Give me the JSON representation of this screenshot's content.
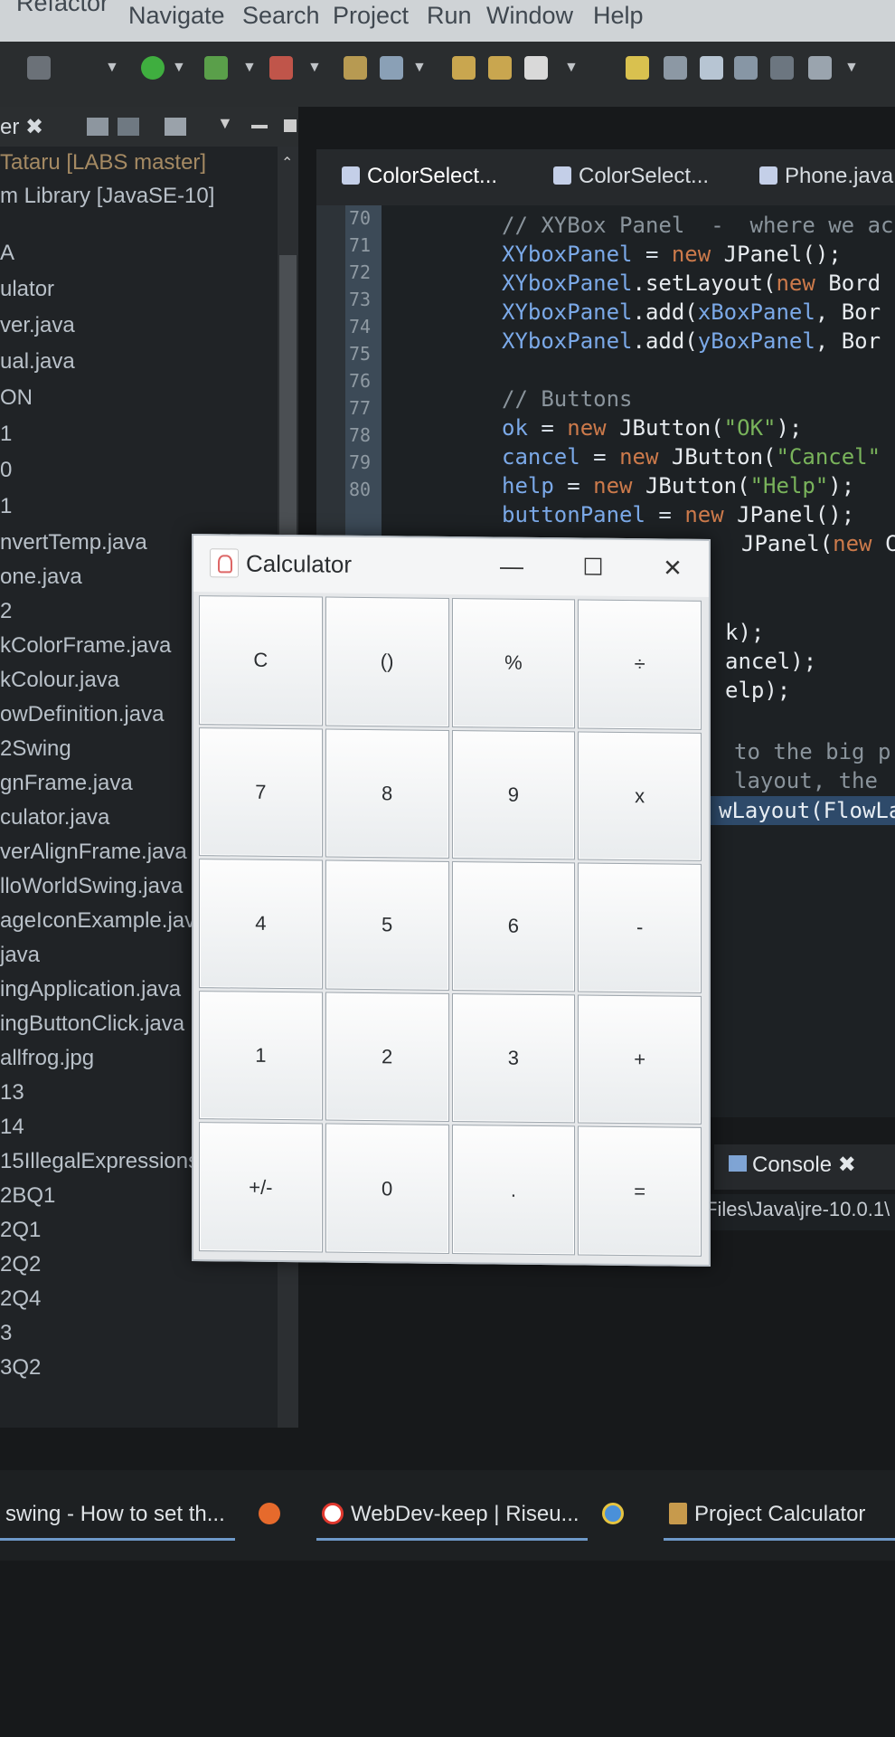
{
  "menu": {
    "items": [
      "Refactor",
      "Navigate",
      "Search",
      "Project",
      "Run",
      "Window",
      "Help"
    ]
  },
  "explorer": {
    "tab_label": "er ✖",
    "rows": [
      "Tataru [LABS master]",
      "m Library [JavaSE-10]",
      "A",
      "ulator",
      "ver.java",
      "ual.java",
      "ON",
      "1",
      "0",
      "1",
      "nvertTemp.java",
      "one.java",
      "2",
      "kColorFrame.java",
      "kColour.java",
      "owDefinition.java",
      "2Swing",
      "gnFrame.java",
      "culator.java",
      "verAlignFrame.java",
      "lloWorldSwing.java",
      "ageIconExample.jav",
      "java",
      "ingApplication.java",
      "ingButtonClick.java",
      "allfrog.jpg",
      "13",
      "14",
      "15IllegalExpressions",
      "2BQ1",
      "2Q1",
      "2Q2",
      "2Q4",
      "3",
      "3Q2"
    ]
  },
  "editor": {
    "tabs": [
      "ColorSelect...",
      "ColorSelect...",
      "Phone.java"
    ],
    "line_numbers": [
      "70",
      "71",
      "72",
      "73",
      "74",
      "75",
      "76",
      "77",
      "78",
      "79",
      "80"
    ],
    "code": {
      "l70": "// XYBox Panel  -  where we ac",
      "l71a": "XYboxPanel",
      "l71b": " = ",
      "l71c": "new",
      "l71d": " JPanel();",
      "l72a": "XYboxPanel",
      "l72b": ".setLayout(",
      "l72c": "new",
      "l72d": " Bord",
      "l73a": "XYboxPanel",
      "l73b": ".add(",
      "l73c": "xBoxPanel",
      "l73d": ", Bor",
      "l74a": "XYboxPanel",
      "l74b": ".add(",
      "l74c": "yBoxPanel",
      "l74d": ", Bor",
      "l76": "// Buttons",
      "l77a": "ok",
      "l77b": " = ",
      "l77c": "new",
      "l77d": " JButton(",
      "l77e": "\"OK\"",
      "l77f": ");",
      "l78a": "cancel",
      "l78b": " = ",
      "l78c": "new",
      "l78d": " JButton(",
      "l78e": "\"Cancel\"",
      "l79a": "help",
      "l79b": " = ",
      "l79c": "new",
      "l79d": " JButton(",
      "l79e": "\"Help\"",
      "l79f": ");",
      "l80a": "buttonPanel",
      "l80b": " = ",
      "l80c": "new",
      "l80d": " JPanel();",
      "r1a": "JPanel(",
      "r1b": "new",
      "r1c": " C",
      "r2": "k);",
      "r3": "ancel);",
      "r4": "elp);",
      "r5": "to the big p",
      "r6": "layout, the",
      "r7": "wLayout(FlowLa"
    }
  },
  "console": {
    "tab_label": "Console ✖",
    "path": "Files\\Java\\jre-10.0.1\\"
  },
  "taskbar": {
    "items": [
      "swing - How to set th...",
      "WebDev-keep | Riseu...",
      "Project Calculator"
    ]
  },
  "calculator": {
    "title": "Calculator",
    "minimize": "—",
    "maximize": "☐",
    "close": "✕",
    "keys": [
      "C",
      "()",
      "%",
      "÷",
      "7",
      "8",
      "9",
      "x",
      "4",
      "5",
      "6",
      "-",
      "1",
      "2",
      "3",
      "+",
      "+/-",
      "0",
      ".",
      "="
    ]
  }
}
